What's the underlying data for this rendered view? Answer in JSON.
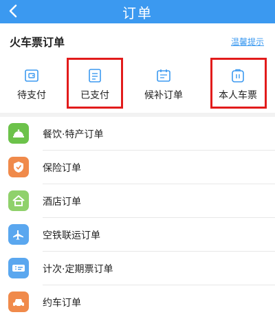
{
  "header": {
    "title": "订单",
    "back_icon": "chevron-left-icon",
    "bg_color": "#3b99f0"
  },
  "train_section": {
    "title": "火车票订单",
    "tip_link": "温馨提示",
    "quick_items": [
      {
        "label": "待支付",
        "icon": "wallet-icon",
        "highlighted": false
      },
      {
        "label": "已支付",
        "icon": "receipt-icon",
        "highlighted": true
      },
      {
        "label": "候补订单",
        "icon": "calendar-list-icon",
        "highlighted": false
      },
      {
        "label": "本人车票",
        "icon": "ticket-bag-icon",
        "highlighted": true
      }
    ]
  },
  "order_list": [
    {
      "label": "餐饮·特产订单",
      "icon": "cloche-icon",
      "color": "#6cc24a"
    },
    {
      "label": "保险订单",
      "icon": "shield-icon",
      "color": "#f08a4b"
    },
    {
      "label": "酒店订单",
      "icon": "house-icon",
      "color": "#8fd16b"
    },
    {
      "label": "空铁联运订单",
      "icon": "plane-train-icon",
      "color": "#5aa7ef"
    },
    {
      "label": "计次·定期票订单",
      "icon": "ticket-icon",
      "color": "#5aa7ef"
    },
    {
      "label": "约车订单",
      "icon": "car-icon",
      "color": "#f08a4b"
    }
  ],
  "highlight_color": "#e21b1b"
}
